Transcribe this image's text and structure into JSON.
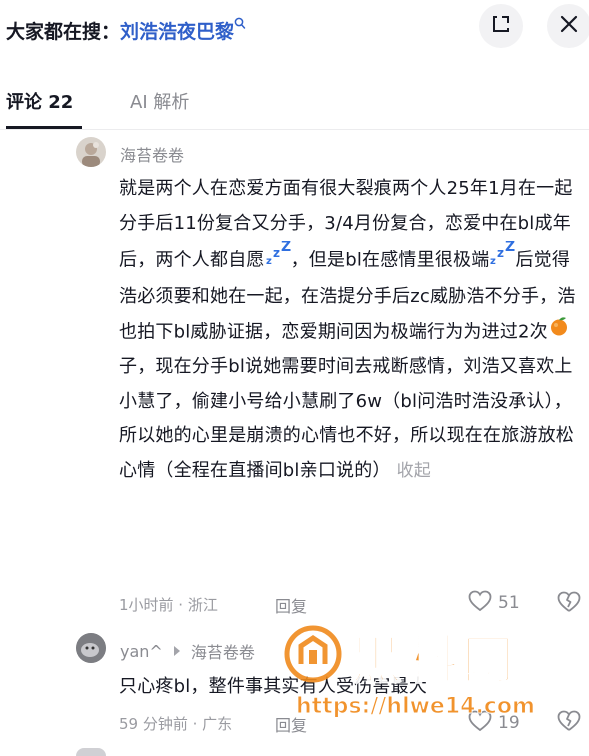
{
  "header": {
    "search_prefix": "大家都在搜：",
    "search_term": "刘浩浩夜巴黎",
    "search_icon": "search-icon",
    "fullscreen_icon": "fullscreen-icon",
    "close_icon": "close-icon"
  },
  "tabs": [
    {
      "label": "评论 22",
      "active": true
    },
    {
      "label": "AI 解析",
      "active": false
    }
  ],
  "comments": [
    {
      "author": "海苔卷卷",
      "text_parts": [
        "就是两个人在恋爱方面有很大裂痕两个人25年1月在一起分手后11份复合又分手，3/4月份复合，恋爱中在bl成年后，两个人都自愿",
        "，但是bl在感情里很极端",
        "后觉得浩必须要和她在一起，在浩提分手后zc威胁浩不分手，浩也拍下bl威胁证据，恋爱期间因为极端行为为进过2次",
        "子，现在分手bl说她需要时间去戒断感情，刘浩又喜欢上小慧了，偷建小号给小慧刷了6w（bl问浩时浩没承认），所以她的心里是崩溃的心情也不好，所以现在在旅游放松心情（全程在直播间bl亲口说的）"
      ],
      "collapse_label": "收起",
      "time_location": "1小时前 · 浙江",
      "reply_label": "回复",
      "likes": "51"
    },
    {
      "author": "yan^",
      "reply_to": "海苔卷卷",
      "text": "只心疼bl，整件事其实有人受伤害最大",
      "time_location": "59 分钟前 · 广东",
      "reply_label": "回复",
      "likes": "19"
    }
  ],
  "watermark": {
    "logo_text": "黑料网",
    "url": "https://hlwe14.com"
  },
  "colors": {
    "accent_link": "#2f5fc9",
    "watermark_orange": "#f08a1c",
    "text_primary": "#161823",
    "text_secondary": "#8a8b91"
  }
}
